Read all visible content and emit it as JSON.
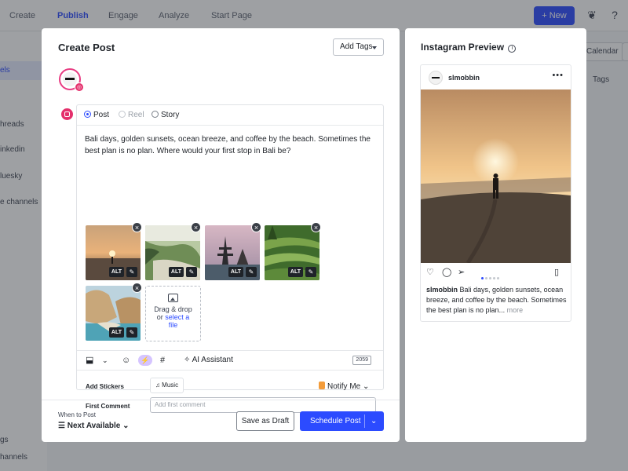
{
  "background": {
    "nav": [
      "Create",
      "Publish",
      "Engage",
      "Analyze",
      "Start Page"
    ],
    "new_label": "+ New",
    "sidebar": [
      "els",
      "hreads",
      "inkedin",
      "luesky",
      "e channels",
      "gs",
      "hannels"
    ],
    "right": {
      "calendar": "Calendar",
      "tags": "Tags"
    }
  },
  "modal": {
    "title": "Create Post",
    "add_tags": "Add Tags",
    "post_types": [
      {
        "label": "Post",
        "checked": true,
        "disabled": false
      },
      {
        "label": "Reel",
        "checked": false,
        "disabled": true
      },
      {
        "label": "Story",
        "checked": false,
        "disabled": false
      }
    ],
    "caption": "Bali days, golden sunsets, ocean breeze, and coffee by the beach. Sometimes the best plan is no plan. Where would your first stop in Bali be?",
    "media": [
      {
        "alt": "ALT",
        "scene": "beach-sunset"
      },
      {
        "alt": "ALT",
        "scene": "coast-cliff"
      },
      {
        "alt": "ALT",
        "scene": "temple"
      },
      {
        "alt": "ALT",
        "scene": "rice-terrace"
      },
      {
        "alt": "ALT",
        "scene": "sea-cliff"
      }
    ],
    "dropzone": {
      "line1": "Drag & drop",
      "line2_prefix": "or ",
      "link": "select a",
      "line3": "file"
    },
    "toolbar": {
      "ai_assistant": "AI Assistant",
      "char_count": "2059",
      "hashtag": "#"
    },
    "add_stickers_label": "Add Stickers",
    "music_label": "Music",
    "notify_label": "Notify Me",
    "first_comment_label": "First Comment",
    "first_comment_placeholder": "Add first comment",
    "when_label": "When to Post",
    "when_value": "Next Available",
    "save_draft": "Save as Draft",
    "schedule": "Schedule Post"
  },
  "preview": {
    "title": "Instagram Preview",
    "username": "slmobbin",
    "caption_user": "slmobbin",
    "caption_text": "Bali days, golden sunsets, ocean breeze, and coffee by the beach. Sometimes the best plan is no plan...",
    "more": "more"
  },
  "colors": {
    "accent": "#2c4bff",
    "instagram": "#e4306c",
    "ai": "#d5c4ff"
  }
}
